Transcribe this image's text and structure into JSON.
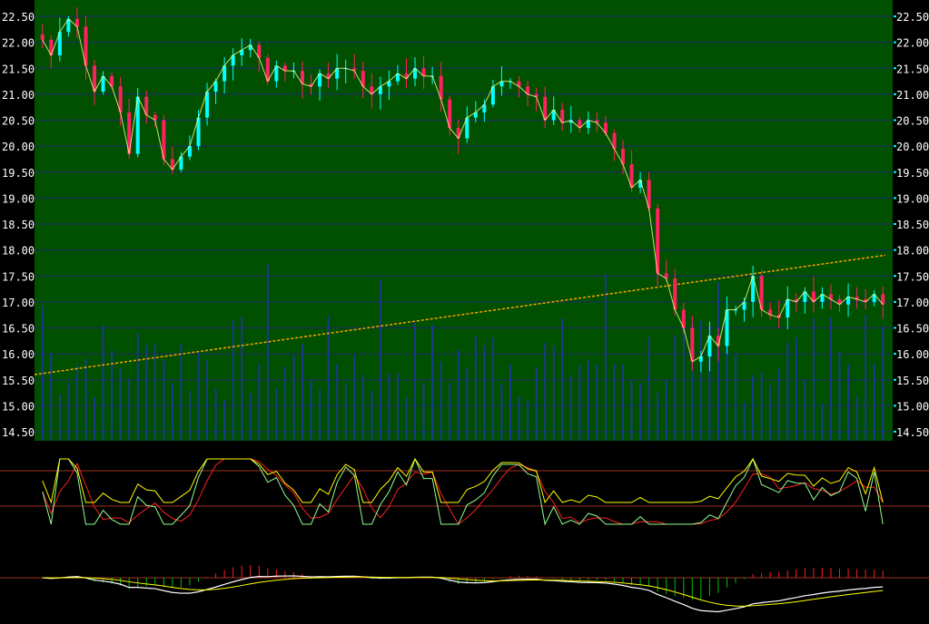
{
  "chart_data": [
    {
      "type": "candlestick",
      "title": "",
      "ylim": [
        14.5,
        22.5
      ],
      "y_ticks": [
        "14.50",
        "15.00",
        "15.50",
        "16.00",
        "16.50",
        "17.00",
        "17.50",
        "18.00",
        "18.50",
        "19.00",
        "19.50",
        "20.00",
        "20.50",
        "21.00",
        "21.50",
        "22.00",
        "22.50"
      ],
      "grid": true,
      "background_color": "#005000",
      "up_color": "#00ffff",
      "down_color": "#ff2060",
      "ma_color": "#ffa000",
      "close": [
        22.05,
        21.75,
        22.2,
        22.45,
        22.3,
        21.55,
        21.05,
        21.35,
        21.15,
        20.65,
        19.85,
        20.95,
        20.6,
        20.5,
        19.75,
        19.55,
        19.8,
        20.0,
        20.55,
        21.05,
        21.25,
        21.55,
        21.75,
        21.85,
        21.95,
        21.7,
        21.25,
        21.55,
        21.45,
        21.45,
        21.2,
        21.15,
        21.4,
        21.3,
        21.5,
        21.5,
        21.45,
        21.15,
        21.0,
        21.15,
        21.25,
        21.4,
        21.3,
        21.5,
        21.35,
        21.35,
        20.9,
        20.35,
        20.15,
        20.55,
        20.65,
        20.8,
        21.15,
        21.25,
        21.25,
        21.15,
        21.0,
        20.95,
        20.5,
        20.7,
        20.45,
        20.5,
        20.35,
        20.5,
        20.45,
        20.25,
        19.95,
        19.65,
        19.2,
        19.35,
        18.8,
        17.55,
        17.45,
        16.85,
        16.5,
        15.85,
        15.95,
        16.35,
        16.15,
        16.85,
        16.85,
        17.0,
        17.5,
        16.85,
        16.75,
        16.7,
        17.05,
        17.0,
        17.2,
        17.0,
        17.15,
        17.05,
        16.95,
        17.1,
        17.05,
        17.0,
        17.15,
        16.95
      ],
      "volume_note": "",
      "ma_start": 15.6,
      "ma_end": 17.9
    },
    {
      "type": "line",
      "panel": "oscillator",
      "series_colors": [
        "#ffffff",
        "#ffff00",
        "#ff2020",
        "#90ff90"
      ],
      "reference_levels": [
        "upper",
        "lower"
      ]
    },
    {
      "type": "bar",
      "panel": "macd",
      "series_colors": [
        "#ffffff",
        "#ffff00",
        "#ff2020",
        "#00ff00"
      ]
    }
  ]
}
